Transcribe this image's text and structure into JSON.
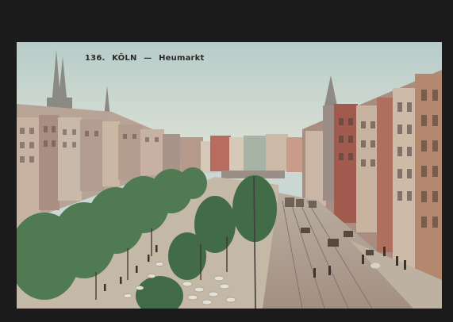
{
  "postcard": {
    "number": "136.",
    "city": "KÖLN",
    "dash": "—",
    "place": "Heumarkt"
  }
}
